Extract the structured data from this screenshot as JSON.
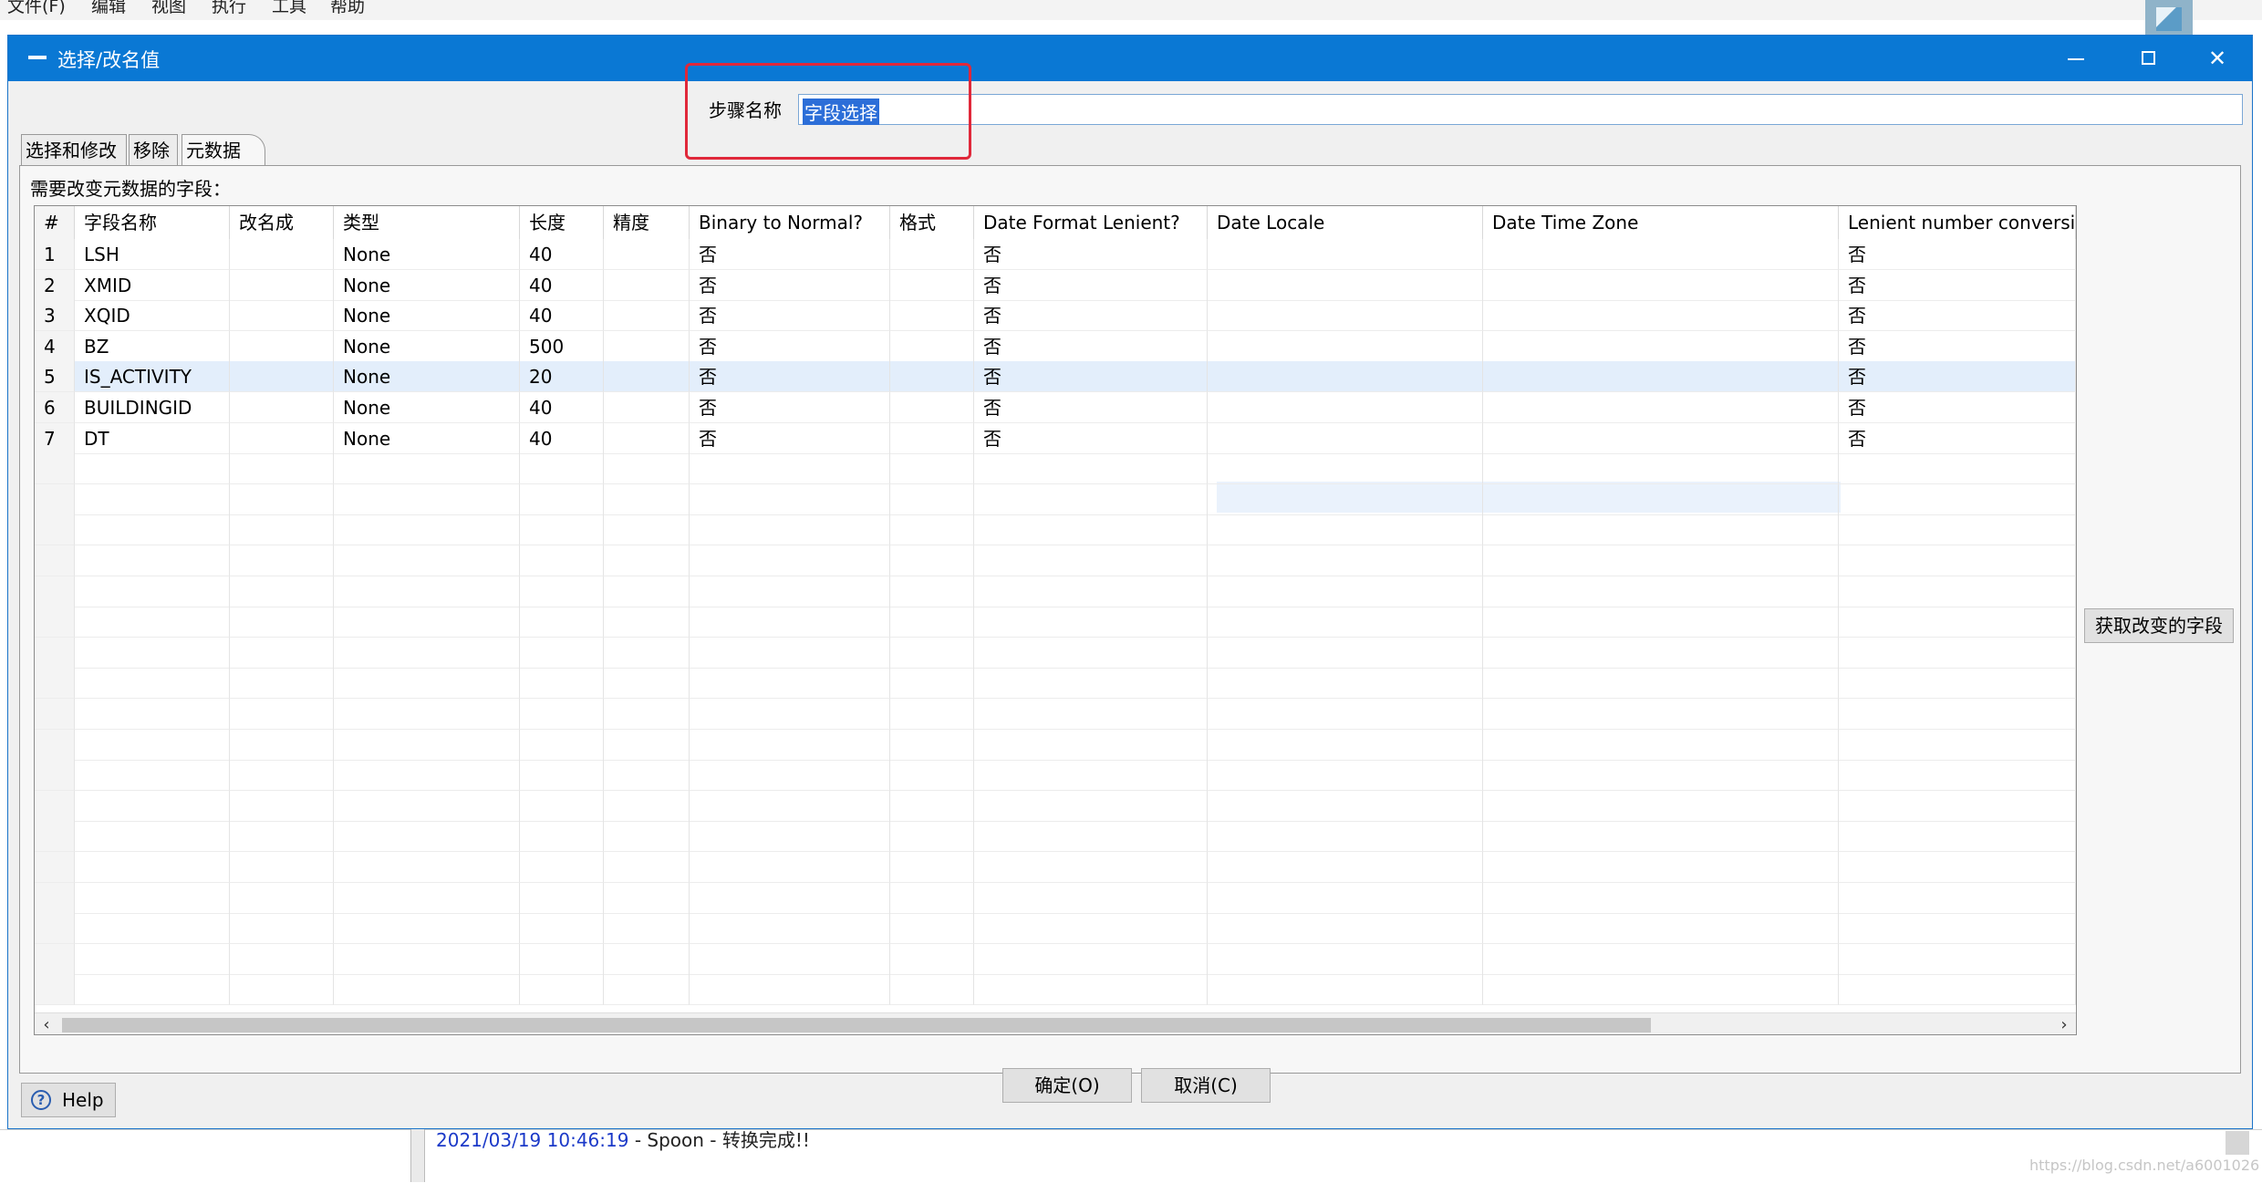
{
  "app": {
    "menu": [
      "文件(F)",
      "编辑",
      "视图",
      "执行",
      "工具",
      "帮助"
    ],
    "log_timestamp": "2021/03/19 10:46:19",
    "log_text": " - Spoon - 转换完成!!",
    "watermark": "https://blog.csdn.net/a6001026"
  },
  "dialog": {
    "title": "选择/改名值",
    "step_name_label": "步骤名称",
    "step_name_value": "字段选择",
    "tabs": [
      "选择和修改",
      "移除",
      "元数据"
    ],
    "active_tab": "元数据",
    "fields_caption": "需要改变元数据的字段：",
    "columns": [
      "#",
      "字段名称",
      "改名成",
      "类型",
      "长度",
      "精度",
      "Binary to Normal?",
      "格式",
      "Date Format Lenient?",
      "Date Locale",
      "Date Time Zone",
      "Lenient number conversi"
    ],
    "rows": [
      [
        "1",
        "LSH",
        "",
        "None",
        "40",
        "",
        "否",
        "",
        "否",
        "",
        "",
        "否"
      ],
      [
        "2",
        "XMID",
        "",
        "None",
        "40",
        "",
        "否",
        "",
        "否",
        "",
        "",
        "否"
      ],
      [
        "3",
        "XQID",
        "",
        "None",
        "40",
        "",
        "否",
        "",
        "否",
        "",
        "",
        "否"
      ],
      [
        "4",
        "BZ",
        "",
        "None",
        "500",
        "",
        "否",
        "",
        "否",
        "",
        "",
        "否"
      ],
      [
        "5",
        "IS_ACTIVITY",
        "",
        "None",
        "20",
        "",
        "否",
        "",
        "否",
        "",
        "",
        "否"
      ],
      [
        "6",
        "BUILDINGID",
        "",
        "None",
        "40",
        "",
        "否",
        "",
        "否",
        "",
        "",
        "否"
      ],
      [
        "7",
        "DT",
        "",
        "None",
        "40",
        "",
        "否",
        "",
        "否",
        "",
        "",
        "否"
      ]
    ],
    "selected_row": 5,
    "get_fields_button": "获取改变的字段",
    "ok_button": "确定(O)",
    "cancel_button": "取消(C)",
    "help_button": "Help",
    "help_icon": "question-circle-icon"
  }
}
